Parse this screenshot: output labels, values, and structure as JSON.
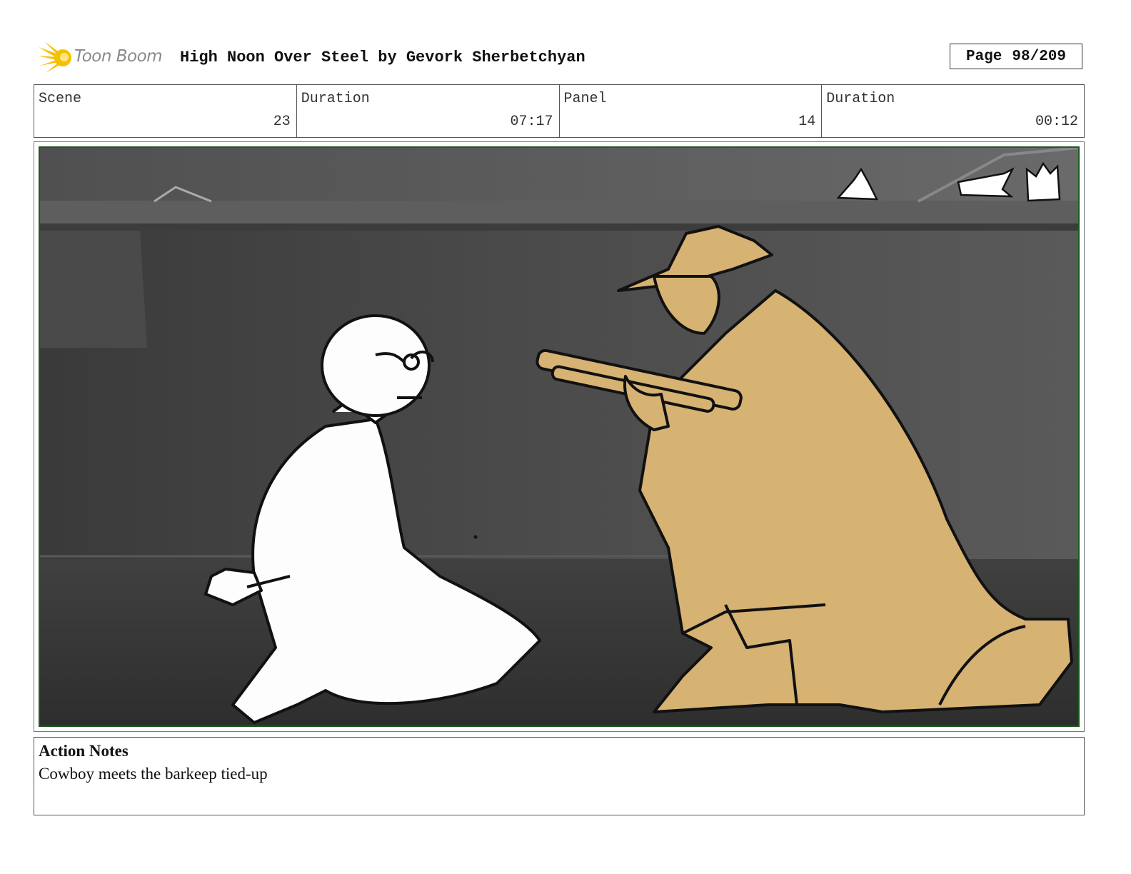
{
  "header": {
    "logo_text": "Toon Boom",
    "title": "High Noon Over Steel by Gevork Sherbetchyan",
    "page_label": "Page",
    "page_value": "98/209"
  },
  "info": {
    "scene_label": "Scene",
    "scene_value": "23",
    "duration_label": "Duration",
    "duration_value": "07:17",
    "panel_label": "Panel",
    "panel_value": "14",
    "panel_duration_label": "Duration",
    "panel_duration_value": "00:12"
  },
  "notes": {
    "heading": "Action Notes",
    "text": "Cowboy meets the barkeep tied-up"
  },
  "colors": {
    "logo_yellow": "#f5c000",
    "cowboy_fill": "#d6b273",
    "panel_border": "#1e5a1e"
  },
  "icons": {
    "logo": "toon-boom-star-icon"
  }
}
